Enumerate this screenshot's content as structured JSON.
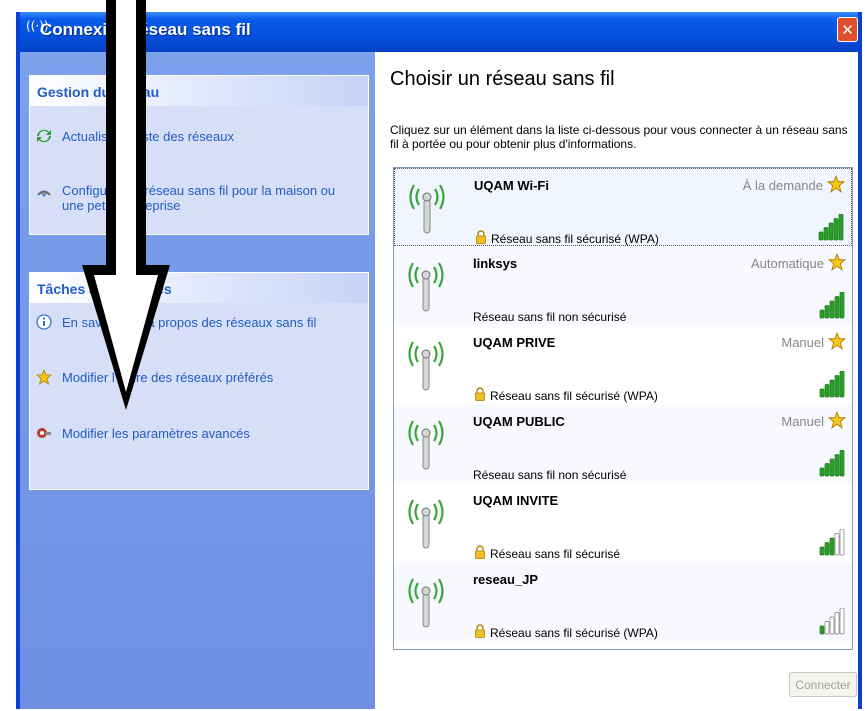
{
  "window": {
    "title": "Connexion réseau sans fil",
    "title_icon": "wireless-network-icon",
    "close_glyph": "✕"
  },
  "left_pane": {
    "network_tasks": {
      "header": "Gestion du réseau",
      "items": [
        {
          "label": "Actualiser la liste des réseaux",
          "icon": "refresh-icon"
        },
        {
          "label": "Configurer un réseau sans fil pour la maison ou une petite entreprise",
          "icon": "setup-wizard-icon"
        }
      ]
    },
    "related_tasks": {
      "header": "Tâches apparentées",
      "items": [
        {
          "label": "En savoir plus à propos des réseaux sans fil",
          "icon": "info-icon"
        },
        {
          "label": "Modifier l'ordre des réseaux préférés",
          "icon": "star-icon"
        },
        {
          "label": "Modifier les paramètres avancés",
          "icon": "settings-icon"
        }
      ]
    }
  },
  "main": {
    "title": "Choisir un réseau sans fil",
    "description": "Cliquez sur un élément dans la liste ci-dessous pour vous connecter à un réseau sans fil à portée ou pour obtenir plus d'informations.",
    "networks": [
      {
        "name": "UQAM Wi-Fi",
        "mode": "À la demande",
        "preferred": true,
        "security": "Réseau sans fil sécurisé (WPA)",
        "secured": true,
        "signal_bars": 5,
        "selected": true
      },
      {
        "name": "linksys",
        "mode": "Automatique",
        "preferred": true,
        "security": "Réseau sans fil non sécurisé",
        "secured": false,
        "signal_bars": 5,
        "selected": false
      },
      {
        "name": "UQAM PRIVE",
        "mode": "Manuel",
        "preferred": true,
        "security": "Réseau sans fil sécurisé (WPA)",
        "secured": true,
        "signal_bars": 5,
        "selected": false
      },
      {
        "name": "UQAM PUBLIC",
        "mode": "Manuel",
        "preferred": true,
        "security": "Réseau sans fil non sécurisé",
        "secured": false,
        "signal_bars": 5,
        "selected": false
      },
      {
        "name": "UQAM INVITE",
        "mode": "",
        "preferred": false,
        "security": "Réseau sans fil sécurisé",
        "secured": true,
        "signal_bars": 3,
        "selected": false
      },
      {
        "name": "reseau_JP",
        "mode": "",
        "preferred": false,
        "security": "Réseau sans fil sécurisé (WPA)",
        "secured": true,
        "signal_bars": 1,
        "selected": false
      }
    ],
    "connect_button": "Connecter"
  },
  "colors": {
    "titlebar": "#0453e0",
    "task_link": "#215dc6",
    "signal_on": "#2aa02a",
    "signal_off": "#ffffff",
    "overlay_arrow": "#000000"
  }
}
